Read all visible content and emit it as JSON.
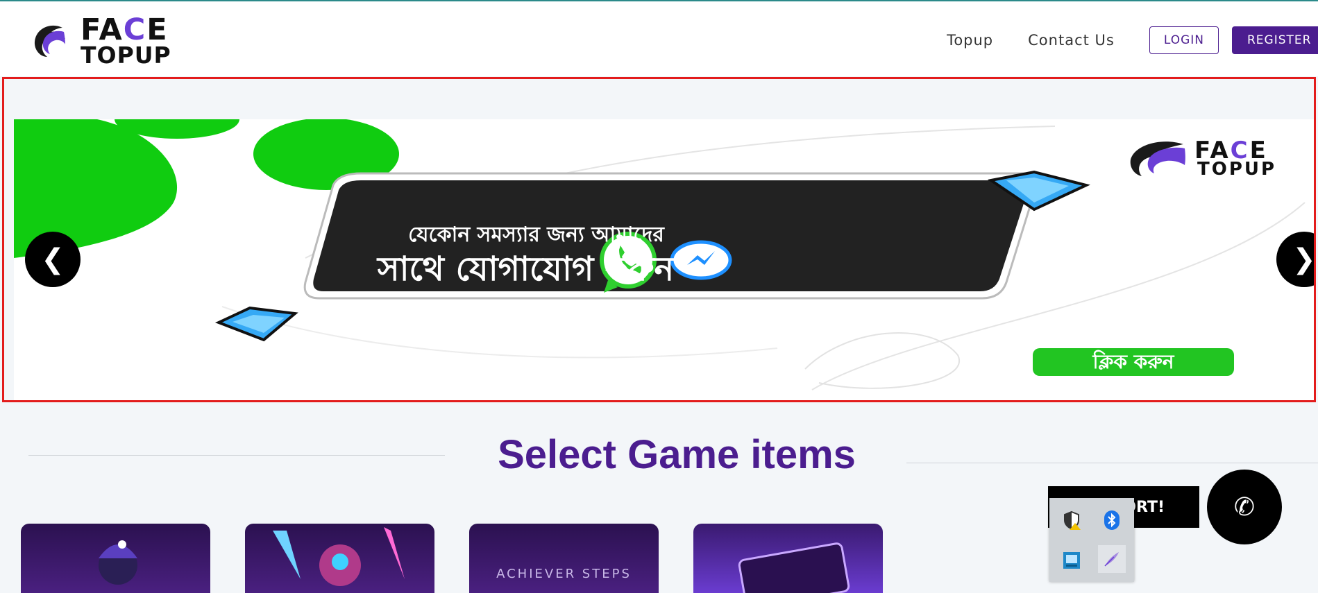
{
  "header": {
    "logo_line1_a": "FA",
    "logo_line1_b": "C",
    "logo_line1_c": "E",
    "logo_line2": "TOPUP",
    "nav": {
      "topup": "Topup",
      "contact": "Contact Us",
      "login": "LOGIN",
      "register": "REGISTER"
    }
  },
  "banner": {
    "line1": "যেকোন সমস্যার জন্য আমাদের",
    "line2": "সাথে যোগাযোগ করুন",
    "cta": "ক্লিক করুন",
    "logo_line1_a": "FA",
    "logo_line1_b": "C",
    "logo_line1_c": "E",
    "logo_line2": "TOPUP",
    "prev_glyph": "❮",
    "next_glyph": "❯"
  },
  "section": {
    "title": "Select Game items"
  },
  "cards": [
    {
      "caption": ""
    },
    {
      "caption": ""
    },
    {
      "caption": "ACHIEVER STEPS"
    },
    {
      "caption": ""
    }
  ],
  "support": {
    "label": "ORT!",
    "phone_glyph": "✆"
  },
  "colors": {
    "brand": "#4b1d8f",
    "accent": "#6b3fd6",
    "banner_green": "#10cc10",
    "frame_red": "#e31c1c"
  },
  "icons": [
    "logo-mark-icon",
    "whatsapp-icon",
    "messenger-icon",
    "diamond-icon",
    "shield-warning-icon",
    "bluetooth-icon",
    "app-icon",
    "feather-icon"
  ]
}
